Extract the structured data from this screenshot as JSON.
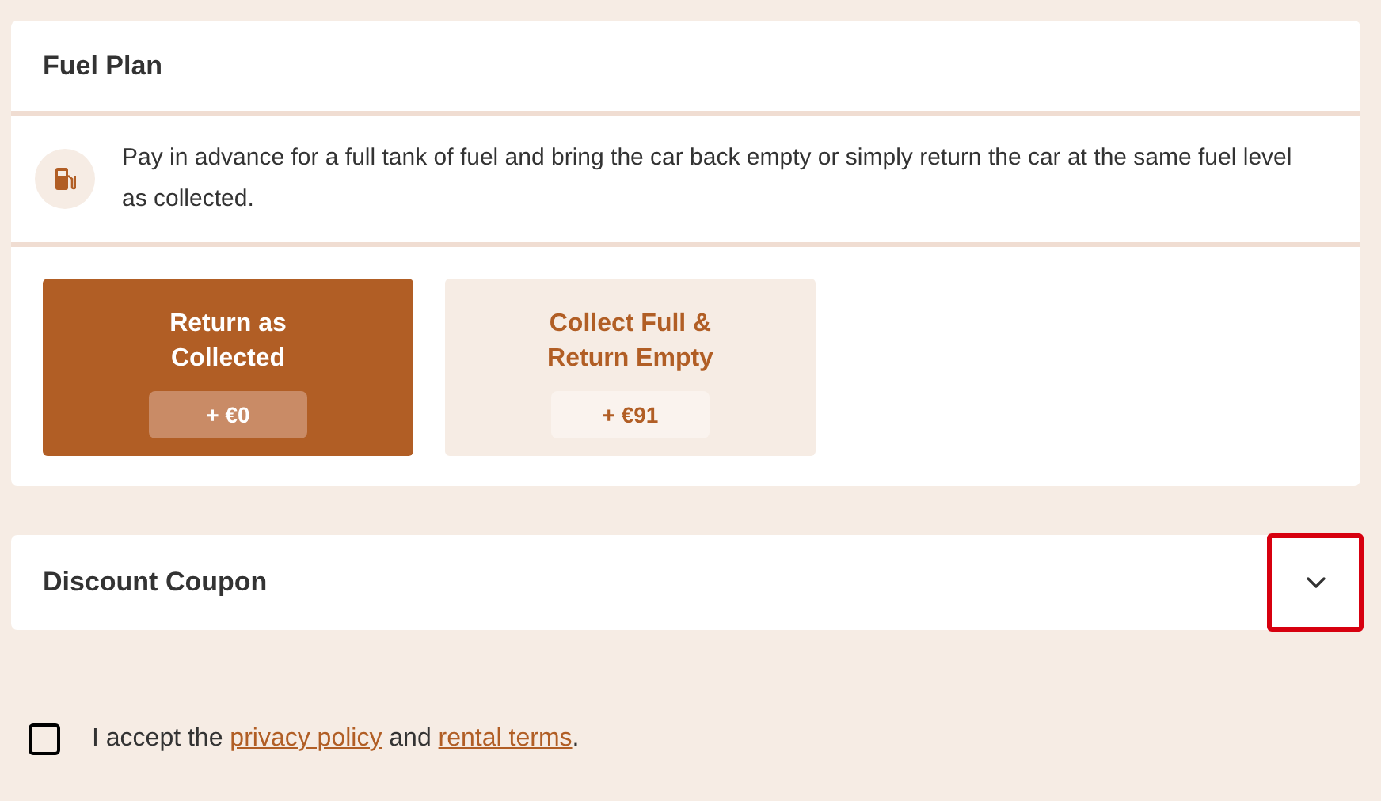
{
  "fuel_plan": {
    "title": "Fuel Plan",
    "description": "Pay in advance for a full tank of fuel and bring the car back empty or simply return the car at the same fuel level as collected.",
    "options": [
      {
        "label": "Return as Collected",
        "price": "+ €0",
        "selected": true
      },
      {
        "label": "Collect Full & Return Empty",
        "price": "+ €91",
        "selected": false
      }
    ]
  },
  "discount_coupon": {
    "title": "Discount Coupon",
    "expanded": false,
    "highlighted": true
  },
  "consent": {
    "checked": false,
    "parts": [
      {
        "kind": "text",
        "text": "I accept the "
      },
      {
        "kind": "link",
        "text": "privacy policy"
      },
      {
        "kind": "text",
        "text": " and "
      },
      {
        "kind": "link",
        "text": "rental terms"
      },
      {
        "kind": "text",
        "text": "."
      }
    ]
  }
}
